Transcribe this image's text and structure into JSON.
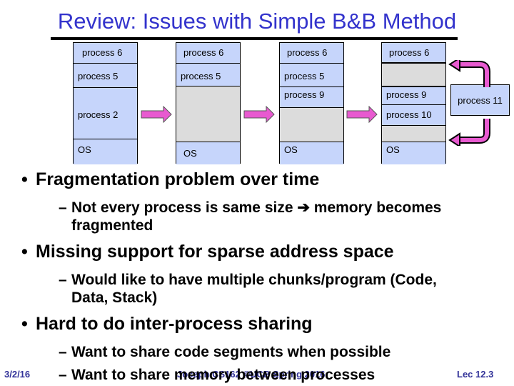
{
  "title": "Review: Issues with Simple B&B Method",
  "diagram": {
    "columns": [
      {
        "segments": [
          {
            "type": "process",
            "label": "process 6"
          },
          {
            "type": "process",
            "label": "process 5"
          },
          {
            "type": "process",
            "label": "process 2"
          },
          {
            "type": "os",
            "label": "OS"
          }
        ]
      },
      {
        "segments": [
          {
            "type": "process",
            "label": "process 6"
          },
          {
            "type": "process",
            "label": "process 5"
          },
          {
            "type": "hole",
            "label": ""
          },
          {
            "type": "os",
            "label": "OS"
          }
        ]
      },
      {
        "segments": [
          {
            "type": "process",
            "label": "process 6"
          },
          {
            "type": "process",
            "label": "process 5"
          },
          {
            "type": "process",
            "label": "process 9"
          },
          {
            "type": "hole",
            "label": ""
          },
          {
            "type": "os",
            "label": "OS"
          }
        ]
      },
      {
        "segments": [
          {
            "type": "process",
            "label": "process 6"
          },
          {
            "type": "hole",
            "label": ""
          },
          {
            "type": "process",
            "label": "process 9"
          },
          {
            "type": "process",
            "label": "process 10"
          },
          {
            "type": "hole",
            "label": ""
          },
          {
            "type": "os",
            "label": "OS"
          }
        ]
      }
    ],
    "external_process": "process 11",
    "colors": {
      "process": "#c6d5fb",
      "hole": "#dcdcdc",
      "arrow": "#e85ad0",
      "title": "#3333cc"
    }
  },
  "bullets": [
    {
      "text": "Fragmentation problem over time",
      "sub": [
        {
          "line1": "Not every process is same size ➔ memory becomes",
          "line2": "fragmented"
        }
      ]
    },
    {
      "text": "Missing support for sparse address space",
      "sub": [
        {
          "line1": "Would like to have multiple chunks/program (Code,",
          "line2": "Data, Stack)"
        }
      ]
    },
    {
      "text": "Hard to do inter-process sharing",
      "sub": [
        {
          "line1": "Want to share code segments when possible"
        },
        {
          "line1": "Want to share memory between processes"
        }
      ]
    }
  ],
  "footer": {
    "date": "3/2/16",
    "center": "Joseph CS162 ©UCB Spring 2016",
    "slide": "Lec 12.3"
  }
}
